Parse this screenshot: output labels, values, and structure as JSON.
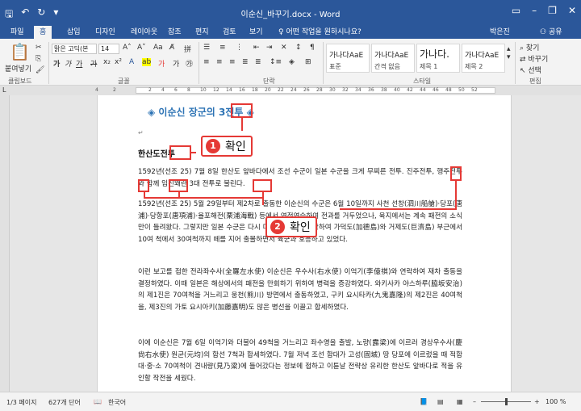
{
  "titlebar": {
    "title": "이순신_바꾸기.docx - Word",
    "icons": [
      "save-icon",
      "undo-icon",
      "redo-icon",
      "customize-icon",
      "ribbon-options-icon",
      "minimize-icon",
      "restore-icon",
      "close-icon"
    ]
  },
  "tabs": [
    "파일",
    "홈",
    "삽입",
    "디자인",
    "레이아웃",
    "참조",
    "편지",
    "검토",
    "보기"
  ],
  "tell_me": "어떤 작업을 원하시나요?",
  "user": "박은진",
  "share": "공유",
  "ribbon": {
    "paste_label": "붙여넣기",
    "clipboard_label": "클립보드",
    "font_label": "글꼴",
    "paragraph_label": "단락",
    "styles_label": "스타일",
    "editing_label": "편집",
    "font_name": "맑은 고딕(본",
    "font_size": "14",
    "find_label": "찾기",
    "replace_label": "바꾸기",
    "select_label": "선택",
    "styles": [
      {
        "sample": "가나다AaE",
        "name": "표준"
      },
      {
        "sample": "가나다AaE",
        "name": "간격 없음"
      },
      {
        "sample": "가나다.",
        "name": "제목 1"
      },
      {
        "sample": "가나다AaE",
        "name": "제목 2"
      }
    ]
  },
  "ruler_marks": [
    "4",
    "2",
    "2",
    "4",
    "6",
    "8",
    "10",
    "12",
    "14",
    "16",
    "18",
    "20",
    "22",
    "24",
    "26",
    "28",
    "30",
    "32",
    "34",
    "36",
    "38",
    "40",
    "42",
    "44",
    "46",
    "48",
    "50",
    "52"
  ],
  "document": {
    "heading": "◈ 이순신 장군의 3전투 ◈",
    "subheading": "한산도전투",
    "para1": "1592년(선조 25) 7월 8일 한산도 앞바다에서 조선 수군이 일본 수군을 크게 무찌른 전투. 진주전투, 행주전투와 함께 임진왜란 3대 전투로 불린다.",
    "para2": "1592년(선조 25) 5월 29일부터 제2차로 출동한 이순신의 수군은 6월 10일까지 사천 선창(泗川船艙)·당포(唐浦)·당항포(唐項浦)·율포해전(栗浦海戰) 등에서 연전연승하여 전과를 거두었으나, 육지에서는 계속 패전의 소식만이 들려왔다. 그렇지만 일본 수군은 다시 머리를 처들기 시작하여 가덕도(加德島)와 거제도(巨濟島) 부근에서 10여 척에서 30여척까지 떼를 지어 출몰하면서 육군과 호응하고 있었다.",
    "para3": "이런 보고를 접한 전라좌수사(全羅左水使) 이순신은 우수사(右水使) 이억기(李億祺)와 연락하여 재차 출동을 결정하였다. 이때 일본은 해상에서의 패전을 만회하기 위하여 병력을 증강하였다. 와키사카 야스하루(脇坂安治)의 제1진은 70여척을 거느리고 웅천(熊川) 방면에서 출동하였고, 구키 요시타카(九鬼嘉隆)의 제2진은 40여척을, 제3진의 가토 요시아키(加藤嘉明)도 많은 병선을 이끌고 합세하였다.",
    "para4": "이에 이순신은 7월 6일 이억기와 더불어 49척을 거느리고 좌수영을 출발, 노량(露梁)에 이르러 경상우수사(慶尙右水使) 원균(元均)의 함선 7척과 합세하였다. 7월 저녁 조선 함대가 고성(固城) 땅 당포에 이르렀을 때 적함 대·중·소 70여척이 견내량(見乃梁)에 들어갔다는 정보에 접하고 이튿날 전략상 유리한 한산도 앞바다로 적을 유인할 작전을 세웠다.",
    "pilcrow": "↵"
  },
  "callouts": [
    {
      "num": "1",
      "text": "확인"
    },
    {
      "num": "2",
      "text": "확인"
    }
  ],
  "status": {
    "page": "1/3 페이지",
    "words": "627개 단어",
    "lang": "한국어",
    "zoom": "100 %"
  },
  "colors": {
    "accent": "#2b579a",
    "highlight": "#e53935",
    "heading": "#2e74b5"
  }
}
